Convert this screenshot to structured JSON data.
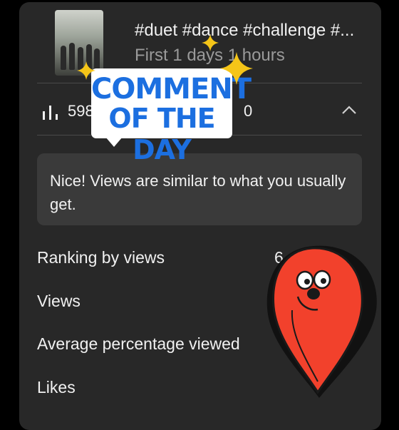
{
  "video": {
    "title": "#duet #dance #challenge #...",
    "age": "First 1 days 1 hours"
  },
  "stats": {
    "views": "598",
    "likes": "0"
  },
  "insight": {
    "message": "Nice! Views are similar to what you usually get."
  },
  "metrics": [
    {
      "label": "Ranking by views",
      "value": "6 of 10"
    },
    {
      "label": "Views",
      "value": ""
    },
    {
      "label": "Average percentage viewed",
      "value": ""
    },
    {
      "label": "Likes",
      "value": ""
    }
  ],
  "badge": {
    "line1": "COMMENT",
    "line2": "OF THE DAY"
  },
  "colors": {
    "panel": "#282828",
    "badge_text": "#1c6fe0",
    "sparkle": "#f5c518",
    "mascot_red": "#f2412c"
  },
  "icons": {
    "stats": "bar-chart-icon",
    "collapse": "chevron-up-icon",
    "ranking": "chevron-right-icon"
  }
}
